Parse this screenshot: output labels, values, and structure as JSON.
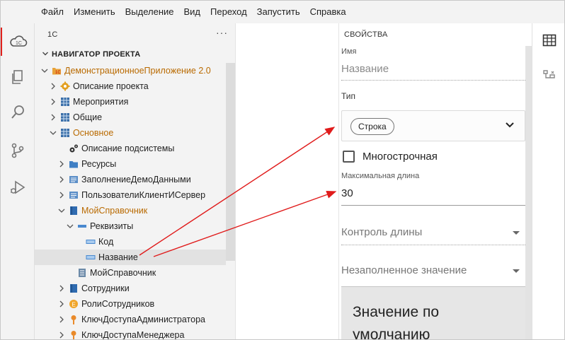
{
  "menu": [
    "Файл",
    "Изменить",
    "Выделение",
    "Вид",
    "Переход",
    "Запустить",
    "Справка"
  ],
  "sidebar": {
    "title": "1С",
    "more": "···",
    "section": "НАВИГАТОР ПРОЕКТА",
    "tree": [
      {
        "label": "ДемонстрационноеПриложение 2.0",
        "icon": "app-folder-icon",
        "twisty": "expanded",
        "orange": true
      },
      {
        "label": "Описание проекта",
        "icon": "gear-icon",
        "twisty": "collapsed"
      },
      {
        "label": "Мероприятия",
        "icon": "grid-icon",
        "twisty": "collapsed"
      },
      {
        "label": "Общие",
        "icon": "grid-icon",
        "twisty": "collapsed"
      },
      {
        "label": "Основное",
        "icon": "grid-icon",
        "twisty": "expanded",
        "orange": true
      },
      {
        "label": "Описание подсистемы",
        "icon": "gears-icon",
        "twisty": "none"
      },
      {
        "label": "Ресурсы",
        "icon": "folder-icon",
        "twisty": "collapsed"
      },
      {
        "label": "ЗаполнениеДемоДанными",
        "icon": "module-icon",
        "twisty": "collapsed"
      },
      {
        "label": "ПользователиКлиентИСервер",
        "icon": "module-icon",
        "twisty": "collapsed"
      },
      {
        "label": "МойСправочник",
        "icon": "catalog-icon",
        "twisty": "expanded",
        "orange": true
      },
      {
        "label": "Реквизиты",
        "icon": "attributes-icon",
        "twisty": "expanded"
      },
      {
        "label": "Код",
        "icon": "attribute-icon",
        "twisty": "none"
      },
      {
        "label": "Название",
        "icon": "attribute-icon",
        "twisty": "none",
        "selected": true
      },
      {
        "label": "МойСправочник",
        "icon": "catalog-form-icon",
        "twisty": "none"
      },
      {
        "label": "Сотрудники",
        "icon": "catalog-icon",
        "twisty": "collapsed"
      },
      {
        "label": "РолиСотрудников",
        "icon": "enum-icon",
        "twisty": "collapsed"
      },
      {
        "label": "КлючДоступаАдминистратора",
        "icon": "key-pin-icon",
        "twisty": "collapsed"
      },
      {
        "label": "КлючДоступаМенеджера",
        "icon": "key-pin-icon",
        "twisty": "collapsed"
      }
    ]
  },
  "properties": {
    "title": "СВОЙСТВА",
    "name_label": "Имя",
    "name_placeholder": "Название",
    "type_label": "Тип",
    "type_value": "Строка",
    "multiline_label": "Многострочная",
    "maxlen_label": "Максимальная длина",
    "maxlen_value": "30",
    "length_control": "Контроль длины",
    "empty_value": "Незаполненное значение",
    "default_value": "Значение по умолчанию"
  },
  "colors": {
    "accent": "#e0211d",
    "tree_orange": "#b96a00",
    "arrow": "#e01b1b"
  }
}
